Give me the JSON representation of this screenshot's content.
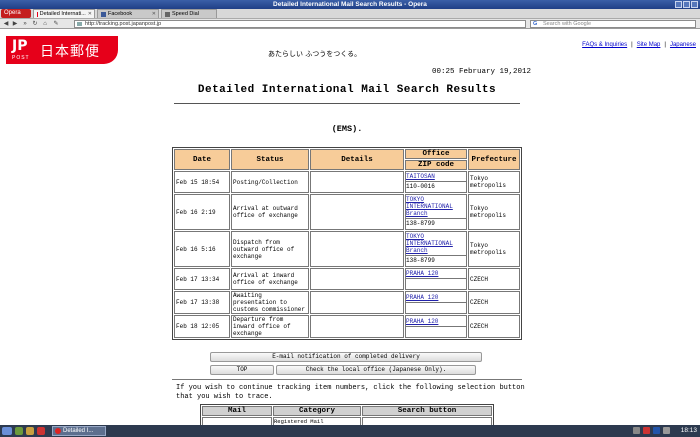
{
  "window": {
    "title": "Detailed International Mail Search Results - Opera"
  },
  "tabs": [
    {
      "label": "Detailed Internati...",
      "active": true
    },
    {
      "label": "Facebook",
      "active": false
    },
    {
      "label": "Speed Dial",
      "active": false
    }
  ],
  "opera_label": "Opera",
  "address": {
    "url": "http://tracking.post.japanpost.jp",
    "search_placeholder": "Search with Google"
  },
  "logo": {
    "mark": "JP",
    "name": "日本郵便",
    "post": "POST"
  },
  "slogan": "あたらしい ふつうをつくる。",
  "toplinks": [
    "FAQs & Inquiries",
    "Site Map",
    "Japanese"
  ],
  "timestamp": "00:25 February 19,2012",
  "page_title": "Detailed International Mail Search Results",
  "service": "(EMS).",
  "table": {
    "headers": {
      "date": "Date",
      "status": "Status",
      "details": "Details",
      "office": "Office",
      "zip": "ZIP code",
      "prefecture": "Prefecture"
    },
    "rows": [
      {
        "date": "Feb 15 18:54",
        "status": "Posting/Collection",
        "details": "",
        "office": "TAITOSAN",
        "zip": "110-0016",
        "prefecture": "Tokyo metropolis"
      },
      {
        "date": "Feb 16 2:19",
        "status": "Arrival at outward office of exchange",
        "details": "",
        "office": "TOKYO INTERNATIONAL Branch",
        "zip": "138-8799",
        "prefecture": "Tokyo metropolis"
      },
      {
        "date": "Feb 16 5:16",
        "status": "Dispatch from outward office of exchange",
        "details": "",
        "office": "TOKYO INTERNATIONAL Branch",
        "zip": "138-8799",
        "prefecture": "Tokyo metropolis"
      },
      {
        "date": "Feb 17 13:34",
        "status": "Arrival at inward office of exchange",
        "details": "",
        "office": "PRAHA 120",
        "zip": "",
        "prefecture": "CZECH"
      },
      {
        "date": "Feb 17 13:38",
        "status": "Awaiting presentation to customs commissioner",
        "details": "",
        "office": "PRAHA 120",
        "zip": "",
        "prefecture": "CZECH"
      },
      {
        "date": "Feb 18 12:05",
        "status": "Departure from inward office of exchange",
        "details": "",
        "office": "PRAHA 120",
        "zip": "",
        "prefecture": "CZECH"
      }
    ]
  },
  "buttons": {
    "email": "E-mail notification of completed delivery",
    "top": "TOP",
    "local": "Check the local office (Japanese Only)."
  },
  "info_text": "If you wish to continue tracking item numbers, click the following selection button that you wish to trace.",
  "bottom_table": {
    "headers": [
      "Mail",
      "Category",
      "Search button"
    ],
    "partial_cell": "Registered Mail"
  },
  "taskbar": {
    "task_label": "Detailed I...",
    "clock": "18:13"
  },
  "colors": {
    "jp_red": "#e6001a",
    "header_orange": "#f7cc99",
    "link": "#2222aa"
  }
}
